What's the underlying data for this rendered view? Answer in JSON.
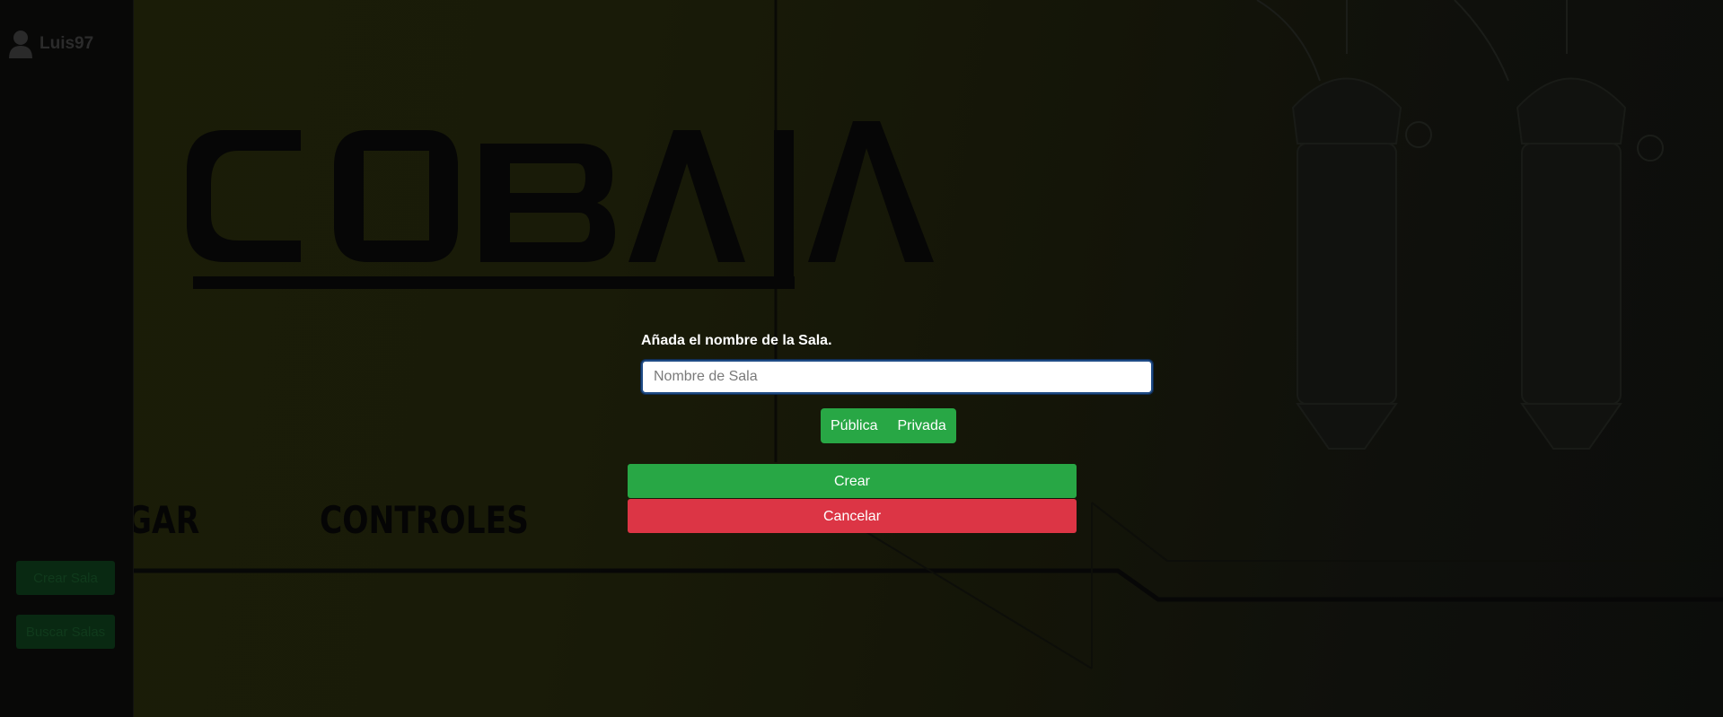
{
  "sidebar": {
    "user": {
      "icon": "user-icon",
      "name": "Luis97"
    },
    "buttons": {
      "crear_sala": "Crear Sala",
      "buscar_salas": "Buscar Salas"
    }
  },
  "background": {
    "logo_text": "COBAIA",
    "menu": {
      "jugar": "JUGAR",
      "controles": "CONTROLES"
    }
  },
  "modal": {
    "prompt": "Añada el nombre de la Sala.",
    "input": {
      "placeholder": "Nombre de Sala",
      "value": ""
    },
    "visibility": {
      "publica": "Pública",
      "privada": "Privada"
    },
    "actions": {
      "crear": "Crear",
      "cancelar": "Cancelar"
    }
  },
  "colors": {
    "success": "#28a745",
    "danger": "#dc3545",
    "input_focus": "#1f4c86"
  }
}
